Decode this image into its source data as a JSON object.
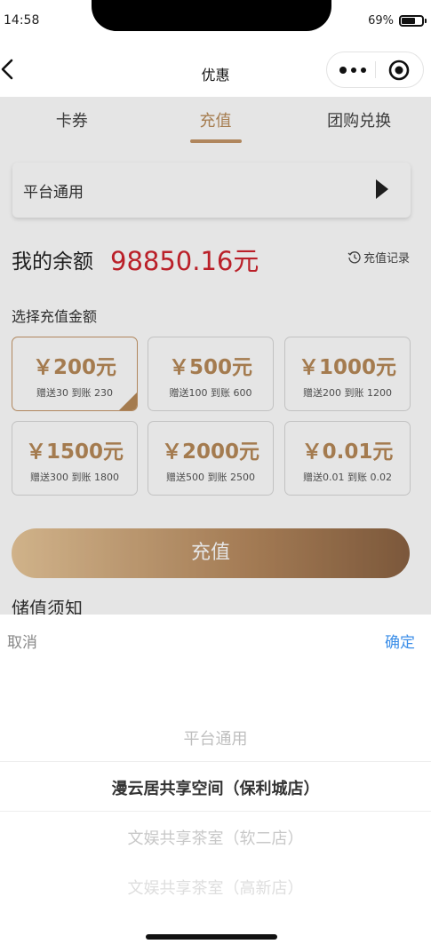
{
  "status_bar": {
    "time": "14:58",
    "battery": "69%"
  },
  "nav": {
    "title": "优惠",
    "back_icon": "chevron-left-icon",
    "more_icon": "more-dots-icon",
    "close_icon": "target-close-icon"
  },
  "tabs": [
    {
      "label": "卡券",
      "active": false
    },
    {
      "label": "充值",
      "active": true
    },
    {
      "label": "团购兑换",
      "active": false
    }
  ],
  "store_select": {
    "label": "平台通用",
    "icon": "triangle-right-icon"
  },
  "balance": {
    "label": "我的余额",
    "value": "98850.16元"
  },
  "history": {
    "label": "充值记录",
    "icon": "history-clock-icon"
  },
  "amount_section": {
    "heading": "选择充值金额",
    "options": [
      {
        "amount": "￥200元",
        "bonus": "赠送30 到账 230",
        "selected": true
      },
      {
        "amount": "￥500元",
        "bonus": "赠送100 到账 600",
        "selected": false
      },
      {
        "amount": "￥1000元",
        "bonus": "赠送200 到账 1200",
        "selected": false
      },
      {
        "amount": "￥1500元",
        "bonus": "赠送300 到账 1800",
        "selected": false
      },
      {
        "amount": "￥2000元",
        "bonus": "赠送500 到账 2500",
        "selected": false
      },
      {
        "amount": "￥0.01元",
        "bonus": "赠送0.01 到账 0.02",
        "selected": false
      }
    ]
  },
  "recharge_button": "充值",
  "notice_title": "储值须知",
  "picker": {
    "cancel": "取消",
    "confirm": "确定",
    "options": [
      "平台通用",
      "漫云居共享空间（保利城店）",
      "文娱共享茶室（软二店）",
      "文娱共享茶室（高新店）"
    ],
    "selected": "漫云居共享空间（保利城店）"
  },
  "colors": {
    "accent": "#b98c5a",
    "balance": "#d0242e",
    "confirm": "#3b8ee8"
  }
}
